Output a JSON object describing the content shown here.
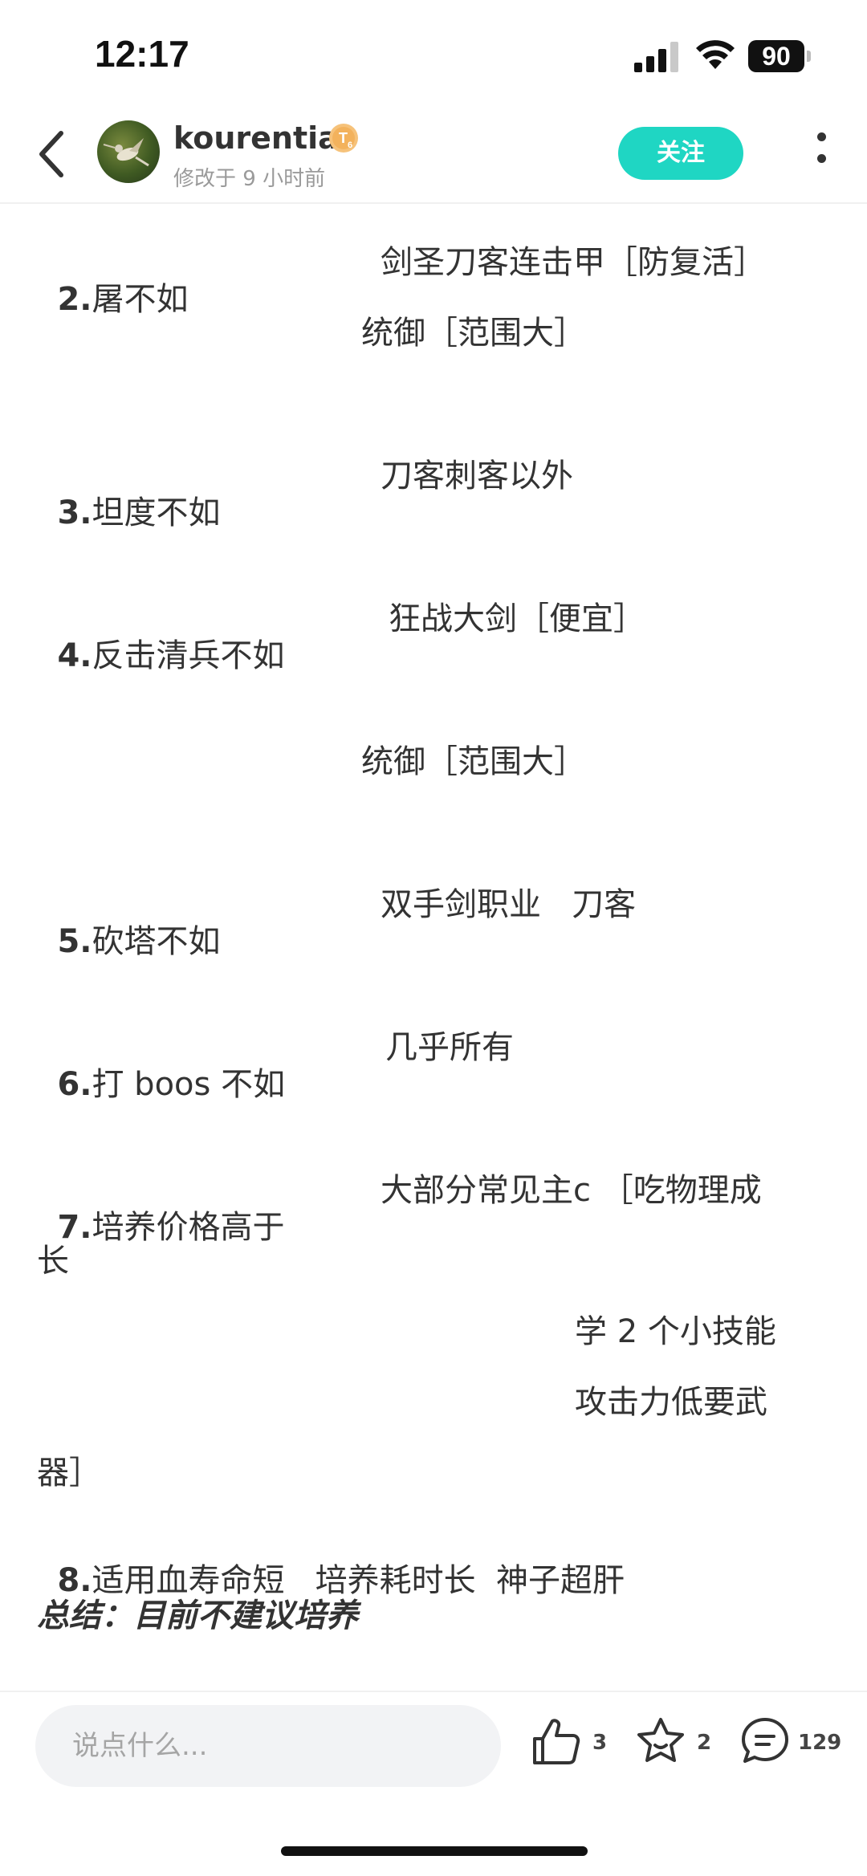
{
  "status_bar": {
    "time": "12:17",
    "battery": "90",
    "icons": [
      "signal-icon",
      "wifi-icon",
      "battery-icon"
    ]
  },
  "header": {
    "username": "kourentia",
    "level_badge": "T6",
    "modified": "修改于 9 小时前",
    "follow_label": "关注"
  },
  "content": {
    "lines": [
      {
        "num": "2.",
        "label": "屠不如",
        "value": "剑圣刀客连击甲［防复活］"
      },
      {
        "indent": "统御［范围大］"
      },
      {
        "num": "3.",
        "label": "坦度不如",
        "value": "刀客刺客以外"
      },
      {
        "num": "4.",
        "label": "反击清兵不如",
        "value": "狂战大剑［便宜］"
      },
      {
        "indent": "统御［范围大］"
      },
      {
        "num": "5.",
        "label": "砍塔不如",
        "value": "双手剑职业   刀客"
      },
      {
        "num": "6.",
        "label": "打 boos 不如",
        "value": "几乎所有"
      },
      {
        "num": "7.",
        "label": "培养价格高于",
        "value": "大部分常见主c ［吃物理成"
      },
      {
        "wrap": "长"
      },
      {
        "indent2": "学 2 个小技能"
      },
      {
        "indent2": "攻击力低要武"
      },
      {
        "wrap": "器］"
      },
      {
        "num": "8.",
        "label": "适用血寿命短   培养耗时长  神子超肝"
      }
    ],
    "summary": "总结：目前不建议培养"
  },
  "bottom_bar": {
    "comment_placeholder": "说点什么...",
    "like_count": "3",
    "favorite_count": "2",
    "comment_count": "129"
  },
  "colors": {
    "accent": "#1fd6c3",
    "text": "#333333",
    "muted": "#9a9a9a",
    "input_bg": "#f2f3f5"
  }
}
